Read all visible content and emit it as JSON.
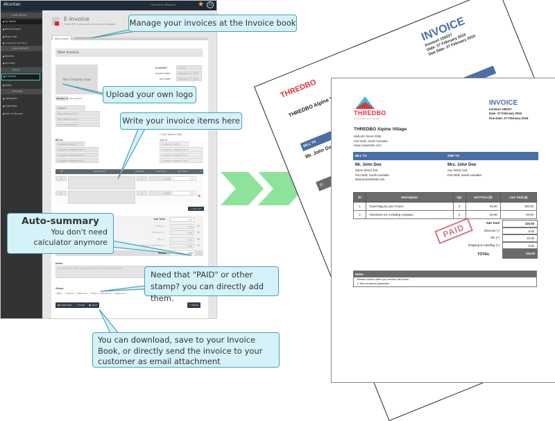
{
  "app": {
    "logo": "Akuntan",
    "greeting": "Hello Kevin Wiegand",
    "sidebar": {
      "sections": [
        {
          "label": "CASH BOOK",
          "items": [
            "My Wallet",
            "Bank Account",
            "Shop Cash",
            "Create New Cash Book"
          ]
        },
        {
          "label": "CASH REPORT",
          "items": [
            "Monthly",
            "Annually"
          ]
        },
        {
          "label": "TOOLS",
          "items": [
            "E-Invoice",
            "Notes"
          ]
        },
        {
          "label": "OPTIONS",
          "items": [
            "Categories",
            "Cash Book",
            "User & Account"
          ]
        }
      ],
      "active": "E-Invoice"
    },
    "page": {
      "title": "E-Invoice",
      "subtitle": "Create PDF invoice and send to your customer"
    },
    "tabs": [
      "New Invoice",
      "Invoice Book"
    ],
    "form": {
      "heading": "New Invoice",
      "logo_placeholder": "Your Company Logo",
      "browse": "Browse...",
      "no_file": "No file selected.",
      "invoice_no_label": "Invoice#*",
      "invoice_no": "150227",
      "invoice_date_label": "Invoice Date*",
      "invoice_date": "February 27, 2015",
      "due_date_label": "Due Date*",
      "due_date": "February 27, 2015",
      "subject": "Subject",
      "address_lines": [
        "Your Address line 1",
        "Your Address line 2",
        "Your Address line 3"
      ],
      "use_ship_to": "Use 'Ship to' field",
      "bill_to": "Bill to",
      "ship_to": "Ship to",
      "bill_fields": [
        "Customer Name *",
        "Customer Address line 1 *",
        "Customer Address line 2",
        "Customer Address line 3"
      ],
      "ship_fields": [
        "Customer Name",
        "Customer Address line 1",
        "Customer Address line 2",
        "Customer Address line 3"
      ],
      "item_headers": [
        "ID*",
        "Description*",
        "Quantity",
        "Unit Price",
        "Line Total",
        "X"
      ],
      "items": [
        {
          "id": "1",
          "qty": "1",
          "price": "0.00",
          "total": "0.00"
        },
        {
          "id": "2",
          "qty": "1",
          "price": "0.00",
          "total": "0.00"
        }
      ],
      "add_item": "+ Add Item",
      "summary": [
        {
          "label": "Sub Total",
          "value": "0.00"
        },
        {
          "label": "Credit (-)",
          "value": "0.00"
        },
        {
          "label": "Discount (-)",
          "value": "0.00"
        },
        {
          "label": "Tax (+)",
          "value": "0.00"
        },
        {
          "label": "Shipping & Handling (+)",
          "value": "0.00"
        }
      ],
      "total_label": "TOTAL",
      "total": "0.00",
      "notes_label": "Notes",
      "notes_placeholder": "You can write some additional notes to your customer here.",
      "stamp_label": "Stamp",
      "stamps": [
        "Paid",
        "Urgent",
        "Past Due",
        "Final",
        "Received",
        "Approved"
      ],
      "buttons": {
        "download": "Download",
        "email": "Email",
        "save": "Save",
        "reset": "Reset"
      }
    }
  },
  "callouts": {
    "manage": "Manage your invoices at the Invoice book",
    "upload": "Upload your own logo",
    "write": "Write your invoice items here",
    "auto_title": "Auto-summary",
    "auto_body": "You don't need calculator anymore",
    "stamp": "Need that \"PAID\" or other stamp? you can directly add them.",
    "download": "You can download, save to your Invoice Book, or directly send the invoice to your customer as email attachment"
  },
  "invoice": {
    "logo_text": "THREDBO",
    "logo_sub": "ALPINE VILLAGE",
    "company": "THREDBO Alpine Village",
    "company_lines": [
      "Malcolm Street 2058",
      "Port Neill, South Australia",
      "www.mywebsite.com"
    ],
    "title": "INVOICE",
    "meta": [
      "Invoice# 150227",
      "Date: 27 February 2015",
      "Due Date: 27 February 2015"
    ],
    "bill_to_label": "BILL TO",
    "ship_to_label": "SHIP TO",
    "bill_name": "Mr. John Doe",
    "bill_lines": [
      "Some Street 123",
      "Port Neill, South Australia",
      "www.yourwebsite.com"
    ],
    "ship_name": "Mrs. John Doe",
    "ship_lines": [
      "Any Street 123",
      "Port Neill, South Australia"
    ],
    "headers": [
      "ID",
      "Description",
      "Qty",
      "Unit Price ($)",
      "Line Total ($)"
    ],
    "rows": [
      [
        "1",
        "Travel Bag by your choice",
        "4",
        "45.00",
        "180.00"
      ],
      [
        "2",
        "Adventure Kit, including compass",
        "2",
        "20.00",
        "40.00"
      ]
    ],
    "totals": [
      {
        "label": "Sub Total",
        "value": "220.00"
      },
      {
        "label": "Discount (-)",
        "value": "5.00"
      },
      {
        "label": "Tax (+)",
        "value": "22.00"
      },
      {
        "label": "Shipping & Handling (+)",
        "value": "5.00"
      }
    ],
    "total_label": "TOTAL",
    "total": "242.00",
    "stamp": "PAID",
    "notes_label": "Notes",
    "notes": [
      "- Please confirm after you receive the items.",
      "- 1 Year products guarantee"
    ]
  },
  "colors": {
    "accent": "#4a6fa5",
    "callout": "#d5f2f8",
    "arrow": "#8ee39a",
    "stamp": "#c0485a"
  }
}
